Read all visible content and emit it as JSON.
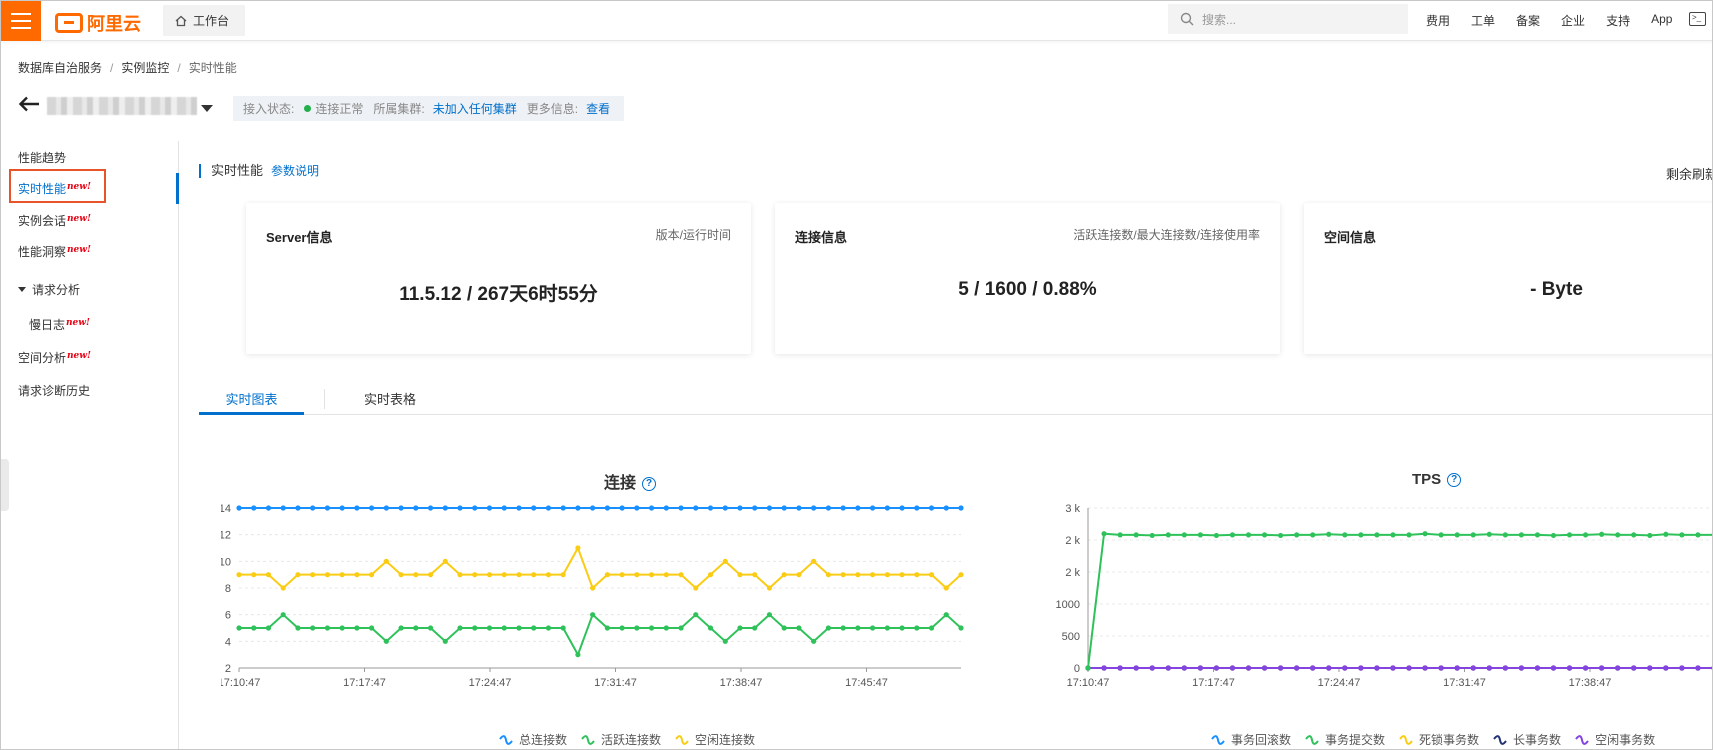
{
  "topbar": {
    "logo_text": "阿里云",
    "workbench_label": "工作台",
    "search_placeholder": "搜索...",
    "nav": [
      "费用",
      "工单",
      "备案",
      "企业",
      "支持",
      "App"
    ],
    "brand_color": "#ff6a00"
  },
  "breadcrumb": [
    "数据库自治服务",
    "实例监控",
    "实时性能"
  ],
  "instance_status": {
    "access_label": "接入状态:",
    "access_value": "连接正常",
    "cluster_label": "所属集群:",
    "cluster_value": "未加入任何集群",
    "more_label": "更多信息:",
    "more_link": "查看"
  },
  "sidebar": {
    "items": [
      {
        "label": "性能趋势",
        "new": false
      },
      {
        "label": "实时性能",
        "new": true
      },
      {
        "label": "实例会话",
        "new": true
      },
      {
        "label": "性能洞察",
        "new": true
      },
      {
        "label": "请求分析",
        "new": false
      },
      {
        "label": "慢日志",
        "new": true
      },
      {
        "label": "空间分析",
        "new": true
      },
      {
        "label": "请求诊断历史",
        "new": false
      }
    ],
    "new_badge": "new!"
  },
  "main": {
    "section_title": "实时性能",
    "param_link": "参数说明",
    "refresh_text": "剩余刷新",
    "cards": [
      {
        "title": "Server信息",
        "sub": "版本/运行时间",
        "value": "11.5.12 / 267天6时55分"
      },
      {
        "title": "连接信息",
        "sub": "活跃连接数/最大连接数/连接使用率",
        "value": "5 / 1600 / 0.88%"
      },
      {
        "title": "空间信息",
        "sub": "",
        "value": "- Byte"
      }
    ],
    "tabs": [
      "实时图表",
      "实时表格"
    ]
  },
  "chart_data": [
    {
      "type": "line",
      "title": "连接",
      "x": [
        "17:10:47",
        "17:17:47",
        "17:24:47",
        "17:31:47",
        "17:38:47",
        "17:45:47"
      ],
      "ylim": [
        2,
        14
      ],
      "yticks": [
        "14",
        "12",
        "10",
        "8",
        "6",
        "4",
        "2"
      ],
      "series": [
        {
          "name": "总连接数",
          "color": "#1890ff",
          "values": [
            14,
            14,
            14,
            14,
            14,
            14,
            14,
            14,
            14,
            14,
            14,
            14,
            14,
            14,
            14,
            14,
            14,
            14,
            14,
            14,
            14,
            14,
            14,
            14,
            14,
            14,
            14,
            14,
            14,
            14,
            14,
            14,
            14,
            14,
            14,
            14,
            14,
            14,
            14,
            14,
            14,
            14,
            14,
            14,
            14,
            14,
            14,
            14,
            14,
            14
          ]
        },
        {
          "name": "活跃连接数",
          "color": "#2fc25b",
          "values": [
            5,
            5,
            5,
            6,
            5,
            5,
            5,
            5,
            5,
            5,
            4,
            5,
            5,
            5,
            4,
            5,
            5,
            5,
            5,
            5,
            5,
            5,
            5,
            3,
            6,
            5,
            5,
            5,
            5,
            5,
            5,
            6,
            5,
            4,
            5,
            5,
            6,
            5,
            5,
            4,
            5,
            5,
            5,
            5,
            5,
            5,
            5,
            5,
            6,
            5
          ]
        },
        {
          "name": "空闲连接数",
          "color": "#facc14",
          "values": [
            9,
            9,
            9,
            8,
            9,
            9,
            9,
            9,
            9,
            9,
            10,
            9,
            9,
            9,
            10,
            9,
            9,
            9,
            9,
            9,
            9,
            9,
            9,
            11,
            8,
            9,
            9,
            9,
            9,
            9,
            9,
            8,
            9,
            10,
            9,
            9,
            8,
            9,
            9,
            10,
            9,
            9,
            9,
            9,
            9,
            9,
            9,
            9,
            8,
            9
          ]
        }
      ]
    },
    {
      "type": "line",
      "title": "TPS",
      "x": [
        "17:10:47",
        "17:17:47",
        "17:24:47",
        "17:31:47",
        "17:38:47"
      ],
      "yticks": [
        "3 k",
        "2 k",
        "2 k",
        "1000",
        "500",
        "0"
      ],
      "series": [
        {
          "name": "事务回滚数",
          "color": "#1890ff",
          "values": [
            0,
            0,
            0,
            0,
            0,
            0,
            0,
            0,
            0,
            0,
            0,
            0,
            0,
            0,
            0,
            0,
            0,
            0,
            0,
            0,
            0,
            0,
            0,
            0,
            0,
            0,
            0,
            0,
            0,
            0,
            0,
            0,
            0,
            0,
            0,
            0,
            0,
            0,
            0,
            0
          ]
        },
        {
          "name": "事务提交数",
          "color": "#2fc25b",
          "values": [
            0,
            2350,
            2330,
            2330,
            2320,
            2330,
            2330,
            2330,
            2320,
            2330,
            2330,
            2330,
            2320,
            2330,
            2330,
            2340,
            2330,
            2330,
            2330,
            2330,
            2330,
            2350,
            2330,
            2330,
            2330,
            2340,
            2330,
            2330,
            2330,
            2320,
            2330,
            2330,
            2340,
            2330,
            2330,
            2320,
            2340,
            2330,
            2330,
            2330
          ]
        },
        {
          "name": "死锁事务数",
          "color": "#facc14",
          "values": [
            0,
            0,
            0,
            0,
            0,
            0,
            0,
            0,
            0,
            0,
            0,
            0,
            0,
            0,
            0,
            0,
            0,
            0,
            0,
            0,
            0,
            0,
            0,
            0,
            0,
            0,
            0,
            0,
            0,
            0,
            0,
            0,
            0,
            0,
            0,
            0,
            0,
            0,
            0,
            0
          ]
        },
        {
          "name": "长事务数",
          "color": "#223273",
          "values": [
            0,
            0,
            0,
            0,
            0,
            0,
            0,
            0,
            0,
            0,
            0,
            0,
            0,
            0,
            0,
            0,
            0,
            0,
            0,
            0,
            0,
            0,
            0,
            0,
            0,
            0,
            0,
            0,
            0,
            0,
            0,
            0,
            0,
            0,
            0,
            0,
            0,
            0,
            0,
            0
          ]
        },
        {
          "name": "空闲事务数",
          "color": "#8543e0",
          "values": [
            0,
            0,
            0,
            0,
            0,
            0,
            0,
            0,
            0,
            0,
            0,
            0,
            0,
            0,
            0,
            0,
            0,
            0,
            0,
            0,
            0,
            0,
            0,
            0,
            0,
            0,
            0,
            0,
            0,
            0,
            0,
            0,
            0,
            0,
            0,
            0,
            0,
            0,
            0,
            0
          ]
        }
      ]
    }
  ]
}
